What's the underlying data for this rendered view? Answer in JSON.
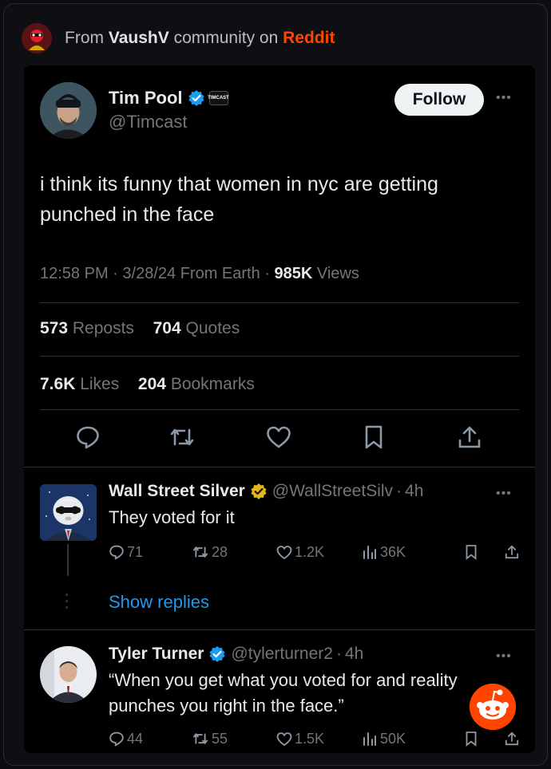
{
  "topbar": {
    "prefix": "From",
    "community": "VaushV",
    "middle": "community on",
    "platform": "Reddit"
  },
  "tweet": {
    "display_name": "Tim Pool",
    "affiliate_badge": "TIMCAST",
    "handle": "@Timcast",
    "follow_label": "Follow",
    "text": "i think its funny that women in nyc are getting punched in the face",
    "time": "12:58 PM",
    "date": "3/28/24",
    "source": "From Earth",
    "views_count": "985K",
    "views_label": "Views",
    "reposts_count": "573",
    "reposts_label": "Reposts",
    "quotes_count": "704",
    "quotes_label": "Quotes",
    "likes_count": "7.6K",
    "likes_label": "Likes",
    "bookmarks_count": "204",
    "bookmarks_label": "Bookmarks"
  },
  "replies": [
    {
      "display_name": "Wall Street Silver",
      "handle": "@WallStreetSilv",
      "time": "4h",
      "text": "They voted for it",
      "replies": "71",
      "reposts": "28",
      "likes": "1.2K",
      "views": "36K",
      "show_replies": "Show replies"
    },
    {
      "display_name": "Tyler Turner",
      "handle": "@tylerturner2",
      "time": "4h",
      "text": "“When you get what you voted for and reality punches you right in the face.”",
      "replies": "44",
      "reposts": "55",
      "likes": "1.5K",
      "views": "50K"
    }
  ],
  "icons": {
    "verified_blue": "#1d9bf0",
    "verified_gold": "#e2b719",
    "reddit": "#ff4500",
    "link": "#1d9bf0"
  }
}
